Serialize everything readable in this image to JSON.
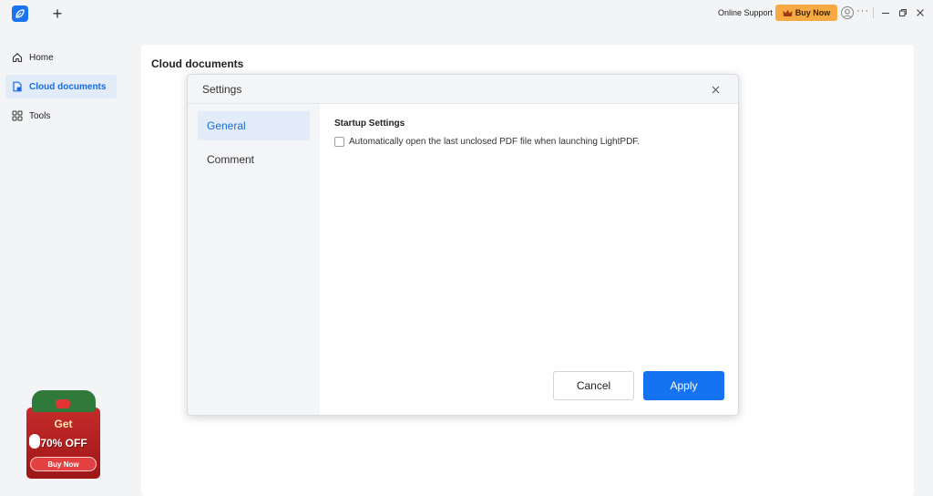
{
  "titlebar": {
    "app_logo_icon": "leaf-logo-icon",
    "new_tab_symbol": "+",
    "online_support": "Online Support",
    "buy_now": "Buy Now",
    "more_symbol": "···"
  },
  "sidebar": {
    "items": [
      {
        "label": "Home",
        "icon": "home-icon"
      },
      {
        "label": "Cloud documents",
        "icon": "cloud-document-icon"
      },
      {
        "label": "Tools",
        "icon": "grid-icon"
      }
    ],
    "active_index": 1
  },
  "promo": {
    "get": "Get",
    "discount": "70% OFF",
    "buy_now": "Buy Now"
  },
  "main": {
    "title": "Cloud documents"
  },
  "dialog": {
    "title": "Settings",
    "nav": [
      {
        "label": "General"
      },
      {
        "label": "Comment"
      }
    ],
    "active_nav_index": 0,
    "section_title": "Startup Settings",
    "checkbox_label": "Automatically open the last unclosed PDF file when launching LightPDF.",
    "checkbox_checked": false,
    "cancel": "Cancel",
    "apply": "Apply"
  },
  "colors": {
    "accent": "#1572f0",
    "active_bg": "#e2ebf8",
    "buy_now_bg": "#f7a944",
    "promo_red": "#c62b2b"
  }
}
